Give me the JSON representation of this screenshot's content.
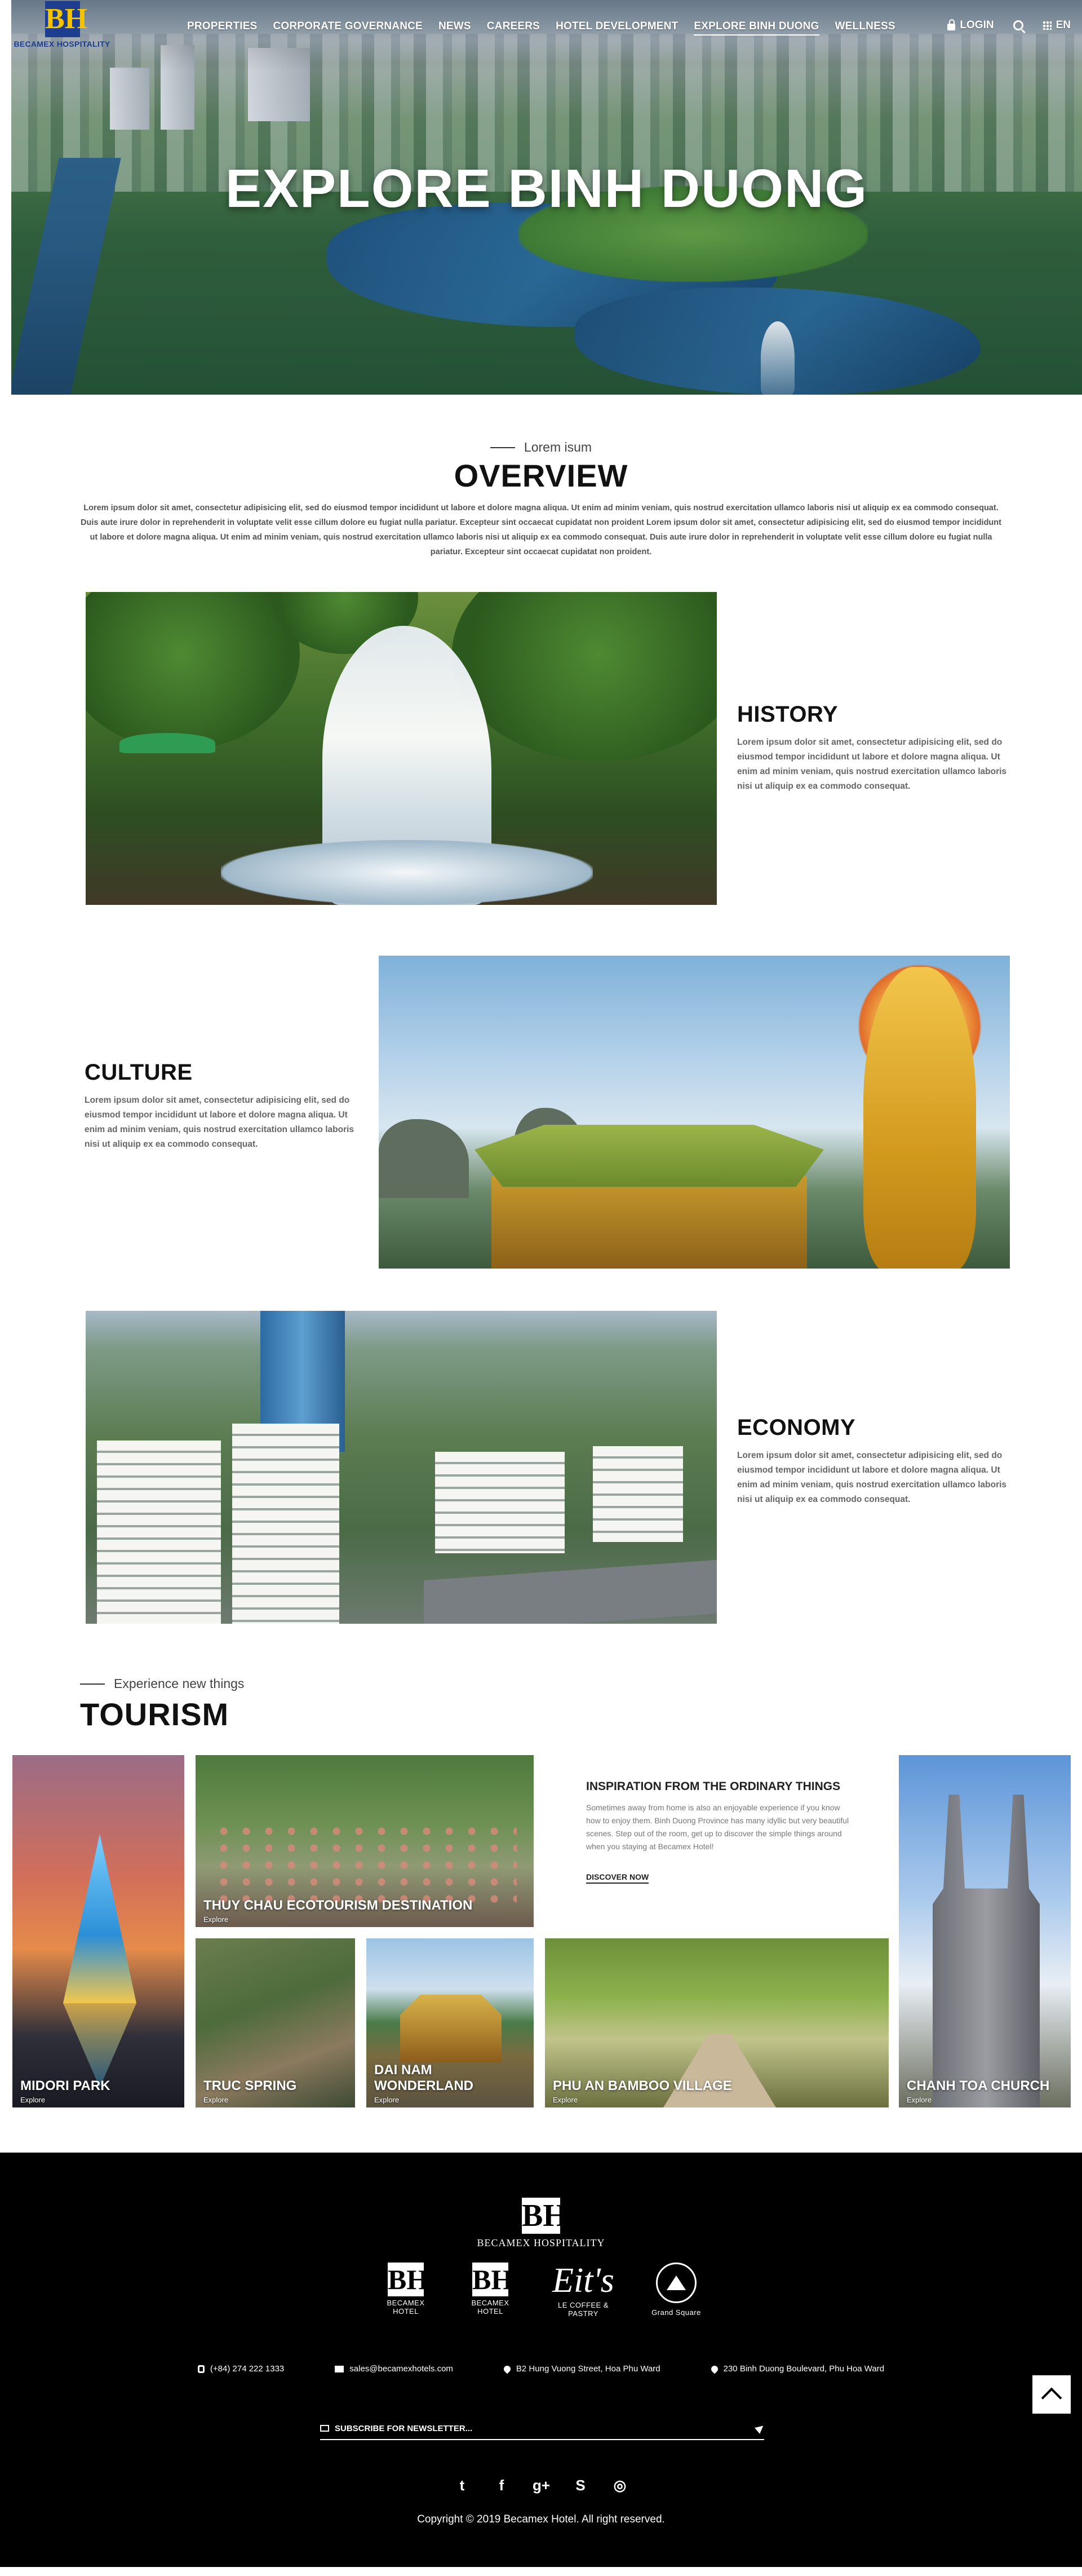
{
  "brand": {
    "logo_letters": "BH",
    "name": "BECAMEX HOSPITALITY",
    "primary_color": "#1d3d8f",
    "accent_color": "#f5c400"
  },
  "nav": {
    "items": [
      "PROPERTIES",
      "CORPORATE GOVERNANCE",
      "NEWS",
      "CAREERS",
      "HOTEL DEVELOPMENT",
      "EXPLORE BINH DUONG",
      "WELLNESS"
    ],
    "active": "EXPLORE BINH DUONG",
    "login": "LOGIN",
    "language": "EN"
  },
  "hero": {
    "title": "EXPLORE BINH DUONG"
  },
  "overview": {
    "eyebrow": "Lorem isum",
    "title": "OVERVIEW",
    "text": "Lorem ipsum dolor sit amet, consectetur adipisicing elit, sed do eiusmod tempor incididunt ut labore et dolore magna aliqua. Ut enim ad minim veniam, quis nostrud exercitation ullamco laboris nisi ut aliquip ex ea commodo consequat. Duis aute irure dolor in reprehenderit in voluptate velit esse cillum dolore eu fugiat nulla pariatur. Excepteur sint occaecat cupidatat non proident Lorem ipsum dolor sit amet, consectetur adipisicing elit, sed do eiusmod tempor incididunt ut labore et dolore magna aliqua. Ut enim ad minim veniam, quis nostrud exercitation ullamco laboris nisi ut aliquip ex ea commodo consequat. Duis aute irure dolor in reprehenderit in voluptate velit esse cillum dolore eu fugiat nulla pariatur. Excepteur sint occaecat cupidatat non proident."
  },
  "sections": [
    {
      "title": "HISTORY",
      "text": "Lorem ipsum dolor sit amet, consectetur adipisicing elit, sed do eiusmod tempor incididunt ut labore et dolore magna aliqua. Ut enim ad minim veniam, quis nostrud exercitation ullamco laboris nisi ut aliquip ex ea commodo consequat."
    },
    {
      "title": "CULTURE",
      "text": "Lorem ipsum dolor sit amet, consectetur adipisicing elit, sed do eiusmod tempor incididunt ut labore et dolore magna aliqua. Ut enim ad minim veniam, quis nostrud exercitation ullamco laboris nisi ut aliquip ex ea commodo consequat."
    },
    {
      "title": "ECONOMY",
      "text": "Lorem ipsum dolor sit amet, consectetur adipisicing elit, sed do eiusmod tempor incididunt ut labore et dolore magna aliqua. Ut enim ad minim veniam, quis nostrud exercitation ullamco laboris nisi ut aliquip ex ea commodo consequat."
    }
  ],
  "tourism": {
    "eyebrow": "Experience new things",
    "title": "TOURISM",
    "explore_label": "Explore",
    "places": {
      "midori": "MIDORI PARK",
      "thuy_chau": "THUY CHAU ECOTOURISM DESTINATION",
      "chanh_toa": "CHANH TOA CHURCH",
      "truc_spring": "TRUC SPRING",
      "dai_nam": "DAI NAM WONDERLAND",
      "phu_an": "PHU AN BAMBOO VILLAGE"
    },
    "inspiration": {
      "title": "INSPIRATION FROM THE ORDINARY THINGS",
      "text": "Sometimes away from home is also an enjoyable experience if you know how to enjoy them. Binh Duong Province has many idyllic but very beautiful scenes. Step out of the room, get up to discover the simple things around when you staying at Becamex Hotel!",
      "cta": "DISCOVER NOW"
    }
  },
  "footer": {
    "logo_letters": "BH",
    "name": "BECAMEX HOSPITALITY",
    "brands": [
      {
        "mark": "BH",
        "label": "BECAMEX HOTEL"
      },
      {
        "mark": "BH",
        "label": "BECAMEX HOTEL"
      },
      {
        "mark": "Eit's",
        "label": "LE COFFEE & PASTRY"
      },
      {
        "mark": "",
        "label": "Grand Square"
      }
    ],
    "phone": "(+84) 274 222 1333",
    "email": "sales@becamexhotels.com",
    "address1": "B2 Hung Vuong Street, Hoa Phu Ward",
    "address2": "230 Binh Duong Boulevard, Phu Hoa Ward",
    "newsletter_placeholder": "SUBSCRIBE FOR NEWSLETTER...",
    "socials": [
      "twitter-icon",
      "facebook-icon",
      "google-plus-icon",
      "skype-icon",
      "instagram-icon"
    ],
    "copyright": "Copyright © 2019 Becamex Hotel. All right reserved."
  }
}
